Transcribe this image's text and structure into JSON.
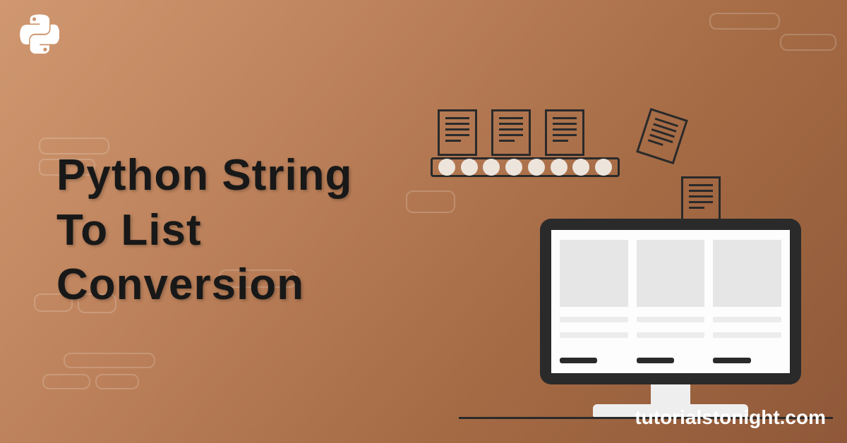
{
  "heading_line1": "Python String",
  "heading_line2": "To List",
  "heading_line3": "Conversion",
  "website": "tutorialstonight.com",
  "logo": "python-logo"
}
